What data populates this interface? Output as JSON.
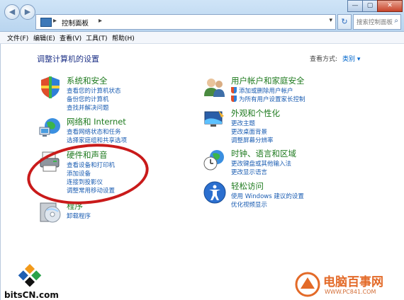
{
  "address": {
    "crumb": "控制面板",
    "sep1": "▸",
    "sep2": "▸"
  },
  "search": {
    "placeholder": "搜索控制面板"
  },
  "window": {
    "minimize": "—",
    "maximize": "▢",
    "close": "✕"
  },
  "menu": [
    "文件(F)",
    "编辑(E)",
    "查看(V)",
    "工具(T)",
    "帮助(H)"
  ],
  "heading": "调整计算机的设置",
  "view": {
    "label": "查看方式:",
    "value": "类别 ▾"
  },
  "categories_left": [
    {
      "title": "系统和安全",
      "links": [
        "查看您的计算机状态",
        "备份您的计算机",
        "查找并解决问题"
      ]
    },
    {
      "title": "网络和 Internet",
      "links": [
        "查看网络状态和任务",
        "选择家庭组和共享选项"
      ]
    },
    {
      "title": "硬件和声音",
      "links": [
        "查看设备和打印机",
        "添加设备",
        "连接到投影仪",
        "调整常用移动设置"
      ]
    },
    {
      "title": "程序",
      "links": [
        "卸载程序"
      ]
    }
  ],
  "categories_right": [
    {
      "title": "用户帐户和家庭安全",
      "links": [
        "添加或删除用户帐户",
        "为所有用户设置家长控制"
      ]
    },
    {
      "title": "外观和个性化",
      "links": [
        "更改主题",
        "更改桌面背景",
        "调整屏幕分辨率"
      ]
    },
    {
      "title": "时钟、语言和区域",
      "links": [
        "更改键盘或其他输入法",
        "更改显示语言"
      ]
    },
    {
      "title": "轻松访问",
      "links": [
        "使用 Windows 建议的设置",
        "优化视频显示"
      ]
    }
  ],
  "watermark": {
    "left": "bitsCN.com",
    "right_title": "电脑百事网",
    "right_url": "WWW.PC841.COM"
  },
  "colors": {
    "title_green": "#1e7a1e",
    "link_blue": "#1a5cb2",
    "heading_blue": "#1e3287",
    "annotation_red": "#c91a1a"
  }
}
